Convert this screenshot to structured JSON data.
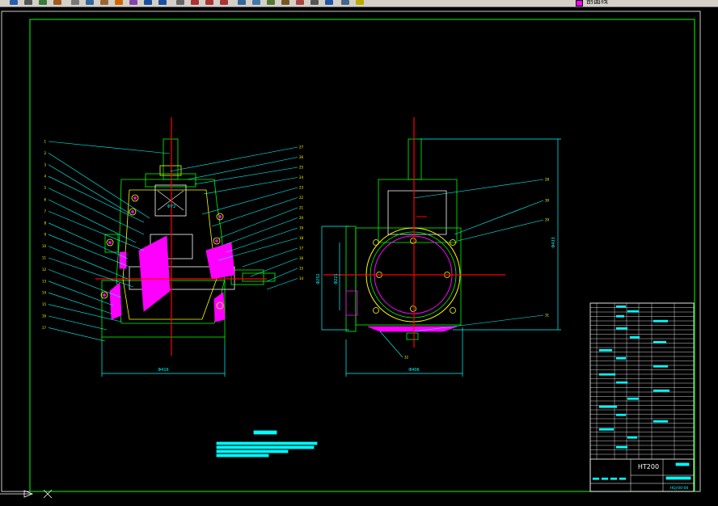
{
  "toolbar": {
    "buttons": [
      {
        "name": "save-button",
        "icon": "save-icon"
      },
      {
        "name": "plot-button",
        "icon": "plot-icon"
      },
      {
        "name": "preview-button",
        "icon": "preview-icon"
      },
      {
        "name": "publish-button",
        "icon": "publish-icon"
      },
      {
        "name": "cut-button",
        "icon": "scissors-icon"
      },
      {
        "name": "copy-button",
        "icon": "copy-icon"
      },
      {
        "name": "paste-button",
        "icon": "paste-icon"
      },
      {
        "name": "match-properties-button",
        "icon": "brush-icon"
      },
      {
        "name": "block-editor-button",
        "icon": "block-icon"
      },
      {
        "name": "undo-button",
        "icon": "undo-icon"
      },
      {
        "name": "redo-button",
        "icon": "redo-icon"
      },
      {
        "name": "pan-button",
        "icon": "hand-icon"
      },
      {
        "name": "zoom-realtime-button",
        "icon": "zoom-icon"
      },
      {
        "name": "zoom-window-button",
        "icon": "zoom-window-icon"
      },
      {
        "name": "zoom-previous-button",
        "icon": "zoom-previous-icon"
      },
      {
        "name": "properties-button",
        "icon": "properties-icon"
      },
      {
        "name": "design-center-button",
        "icon": "design-center-icon"
      },
      {
        "name": "tool-palettes-button",
        "icon": "tool-palettes-icon"
      },
      {
        "name": "sheet-set-button",
        "icon": "sheet-set-icon"
      },
      {
        "name": "markup-button",
        "icon": "markup-icon"
      },
      {
        "name": "calculator-button",
        "icon": "calculator-icon"
      },
      {
        "name": "help-button",
        "icon": "help-icon"
      },
      {
        "name": "layer-manager-button",
        "icon": "layers-icon"
      },
      {
        "name": "layer-state-button",
        "icon": "lightbulb-icon"
      }
    ],
    "current_layer": {
      "name": "剖面线",
      "color": "#ff00ff"
    }
  },
  "drawing": {
    "colors": {
      "background": "#000000",
      "frame": "#00ff00",
      "outline": "#00ff00",
      "body": "#ffff00",
      "center": "#ff0000",
      "hatch": "#ff00ff",
      "leader": "#00ffff",
      "dimension": "#00ffff",
      "white": "#ffffff"
    },
    "dimensions": {
      "left_width": "Φ416",
      "left_inner": "Φ72",
      "right_width": "Φ406",
      "right_height": "Φ433",
      "right_bore": "Φ252",
      "right_inner": "Φ221"
    },
    "left_callouts": [
      "1",
      "2",
      "3",
      "4",
      "5",
      "6",
      "7",
      "8",
      "9",
      "10",
      "11",
      "12",
      "13",
      "14",
      "15",
      "16",
      "17"
    ],
    "right_callouts": [
      "27",
      "26",
      "25",
      "24",
      "23",
      "22",
      "21",
      "20",
      "19",
      "18",
      "17",
      "16",
      "15",
      "14"
    ],
    "title_block": {
      "material": "HT200",
      "drawing_no": "HGJ-00-00"
    }
  }
}
